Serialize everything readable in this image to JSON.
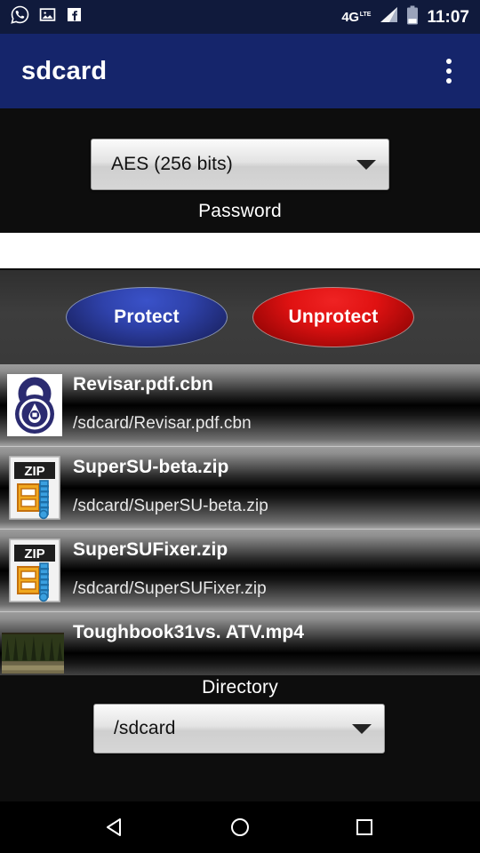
{
  "statusbar": {
    "notification_icons": [
      "whatsapp-icon",
      "gallery-image-icon",
      "facebook-icon"
    ],
    "network_label": "4G",
    "network_sub_label": "LTE",
    "signal_icon": "signal-bars-icon",
    "battery_icon": "battery-low-icon",
    "time": "11:07"
  },
  "appbar": {
    "title": "sdcard",
    "overflow_icon": "overflow-menu-icon"
  },
  "form": {
    "algorithm_selected": "AES (256 bits)",
    "algorithm_caret_icon": "chevron-down-icon",
    "password_label": "Password",
    "password_value": "",
    "password_placeholder": "",
    "protect_label": "Protect",
    "unprotect_label": "Unprotect",
    "protect_color": "#2f42ab",
    "unprotect_color": "#d01010"
  },
  "files": [
    {
      "name": "Revisar.pdf.cbn",
      "path": "/sdcard/Revisar.pdf.cbn",
      "icon": "padlock-icon"
    },
    {
      "name": "SuperSU-beta.zip",
      "path": "/sdcard/SuperSU-beta.zip",
      "icon": "zip-file-icon",
      "icon_label": "ZIP"
    },
    {
      "name": "SuperSUFixer.zip",
      "path": "/sdcard/SuperSUFixer.zip",
      "icon": "zip-file-icon",
      "icon_label": "ZIP"
    },
    {
      "name": "Toughbook31vs. ATV.mp4",
      "path": "",
      "icon": "video-thumbnail-icon"
    }
  ],
  "directory": {
    "label": "Directory",
    "selected": "/sdcard",
    "caret_icon": "chevron-down-icon"
  },
  "navbar": {
    "back": "back-triangle-icon",
    "home": "home-circle-icon",
    "recents": "recents-square-icon"
  }
}
